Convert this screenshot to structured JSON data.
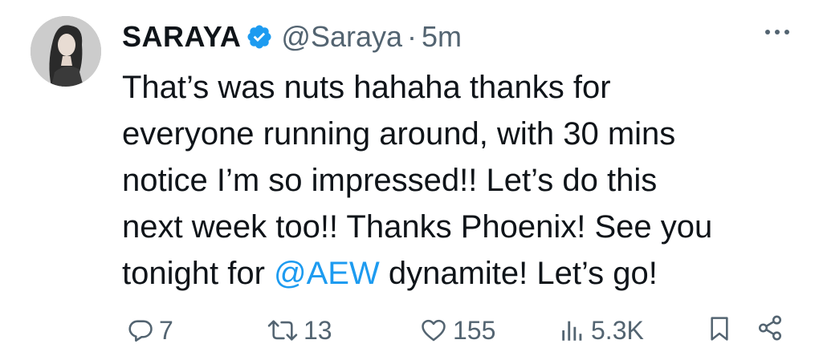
{
  "author": {
    "display_name": "SARAYA",
    "handle": "@Saraya",
    "separator": "·",
    "time": "5m",
    "avatar_icon": "profile-photo",
    "verified_icon": "verified-badge-icon",
    "verified_color": "#1d9bf0"
  },
  "tweet": {
    "line1": "That’s was nuts hahaha thanks for",
    "line2": "everyone running around, with 30 mins",
    "line3": "notice I’m so impressed!! Let’s do this",
    "line4": "next week too!! Thanks Phoenix! See you",
    "line5_before": "tonight for ",
    "mention": "@AEW",
    "line5_after": " dynamite! Let’s go!",
    "mention_color": "#1d9bf0"
  },
  "actions": {
    "reply_count": "7",
    "repost_count": "13",
    "like_count": "155",
    "views_count": "5.3K",
    "reply_icon": "reply-icon",
    "repost_icon": "repost-icon",
    "like_icon": "heart-icon",
    "views_icon": "views-icon",
    "bookmark_icon": "bookmark-icon",
    "share_icon": "share-icon"
  },
  "more_icon": "more-options-icon"
}
